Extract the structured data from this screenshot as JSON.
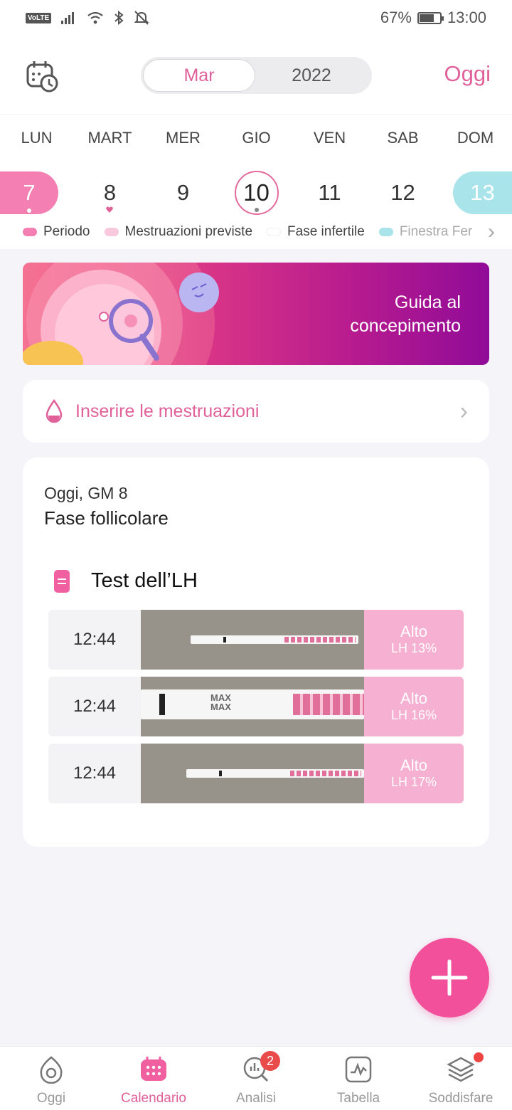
{
  "status": {
    "volte": "VoLTE",
    "battery": "67%",
    "time": "13:00"
  },
  "header": {
    "month": "Mar",
    "year": "2022",
    "today_button": "Oggi"
  },
  "week": {
    "weekdays": [
      "LUN",
      "MART",
      "MER",
      "GIO",
      "VEN",
      "SAB",
      "DOM"
    ],
    "days": [
      "7",
      "8",
      "9",
      "10",
      "11",
      "12",
      "13"
    ]
  },
  "legend": [
    "Periodo",
    "Mestruazioni previste",
    "Fase infertile",
    "Finestra Fer"
  ],
  "banner": {
    "title": "Guida al concepimento"
  },
  "period_input": {
    "label": "Inserire le mestruazioni"
  },
  "card": {
    "cycle_day": "Oggi, GM 8",
    "phase": "Fase follicolare",
    "lh_title": "Test dell’LH",
    "tests": [
      {
        "time": "12:44",
        "result": "Alto",
        "value": "LH 13%"
      },
      {
        "time": "12:44",
        "result": "Alto",
        "value": "LH 16%"
      },
      {
        "time": "12:44",
        "result": "Alto",
        "value": "LH 17%"
      }
    ]
  },
  "nav": {
    "items": [
      {
        "label": "Oggi"
      },
      {
        "label": "Calendario"
      },
      {
        "label": "Analisi",
        "badge": "2"
      },
      {
        "label": "Tabella"
      },
      {
        "label": "Soddisfare"
      }
    ]
  },
  "colors": {
    "accent": "#e0619a",
    "period": "#f37fb3",
    "fertile": "#a8e4ea",
    "fab": "#f2509a"
  }
}
